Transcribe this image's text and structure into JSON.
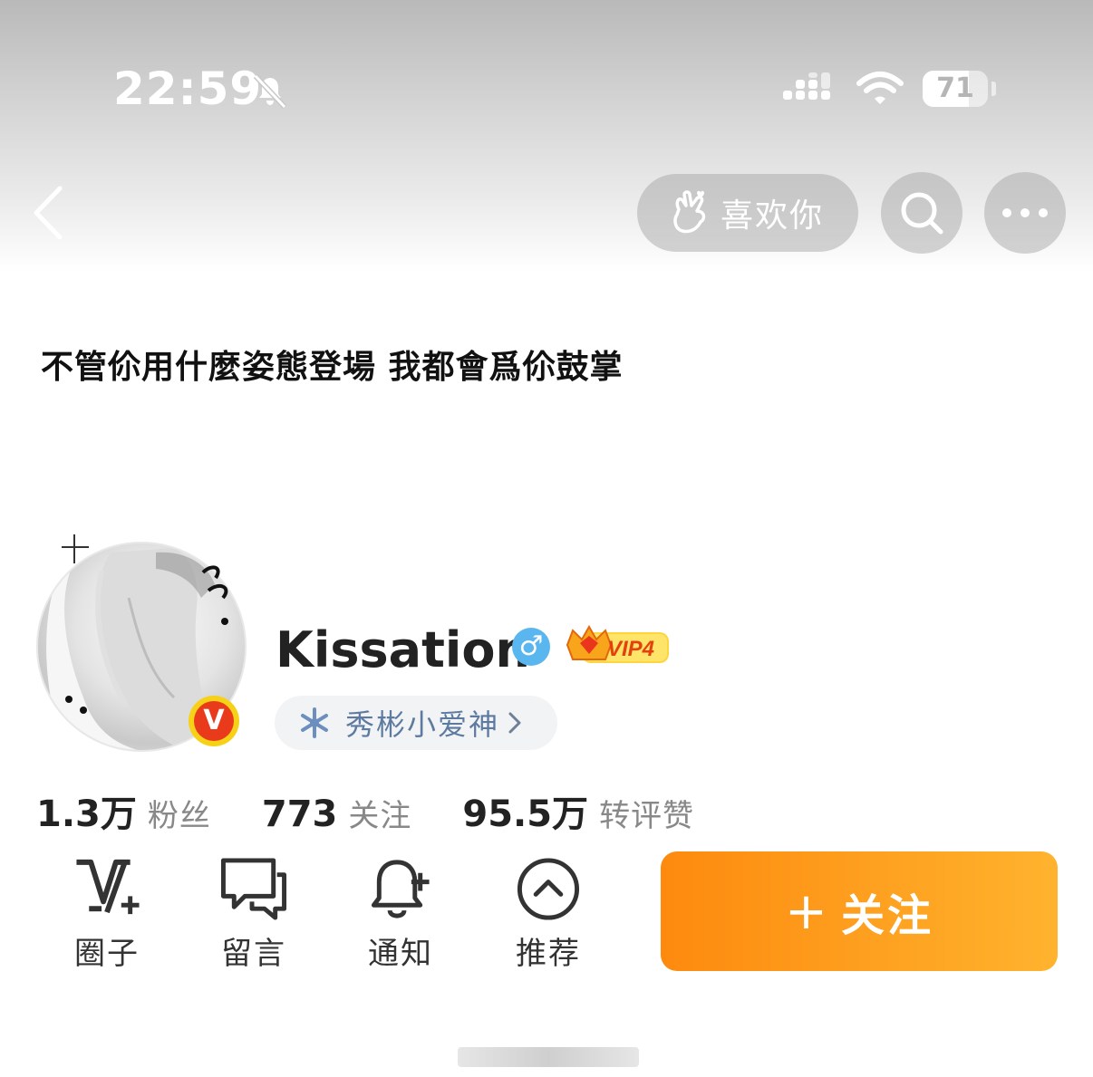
{
  "status_bar": {
    "time": "22:59",
    "battery_level": "71",
    "battery_fraction": 0.71,
    "icons": [
      "bell-slash-icon",
      "signal-icon",
      "wifi-icon",
      "battery-icon"
    ]
  },
  "nav": {
    "back_icon": "chevron-left-icon",
    "like_label": "喜欢你",
    "like_icon": "heart-hand-icon",
    "search_icon": "search-icon",
    "more_icon": "more-dots-icon"
  },
  "banner": {
    "text": "不管伱用什麼姿態登場 我都會爲伱鼓掌"
  },
  "profile": {
    "name": "Kissation",
    "gender_symbol": "♂",
    "gender_color": "#59b6ef",
    "vip_label": "VIP4",
    "verified_badge": "V",
    "tag_label": "秀彬小爱神"
  },
  "stats": [
    {
      "value": "1.3万",
      "label": "粉丝"
    },
    {
      "value": "773",
      "label": "关注"
    },
    {
      "value": "95.5万",
      "label": "转评赞"
    }
  ],
  "actions": [
    {
      "label": "圈子",
      "icon": "circle-v-plus-icon"
    },
    {
      "label": "留言",
      "icon": "message-bubbles-icon"
    },
    {
      "label": "通知",
      "icon": "bell-plus-icon"
    },
    {
      "label": "推荐",
      "icon": "chevron-up-circle-icon"
    }
  ],
  "follow_button": {
    "plus": "+",
    "label": "关注",
    "color_start": "#fd8a0f",
    "color_end": "#ffb32e"
  }
}
